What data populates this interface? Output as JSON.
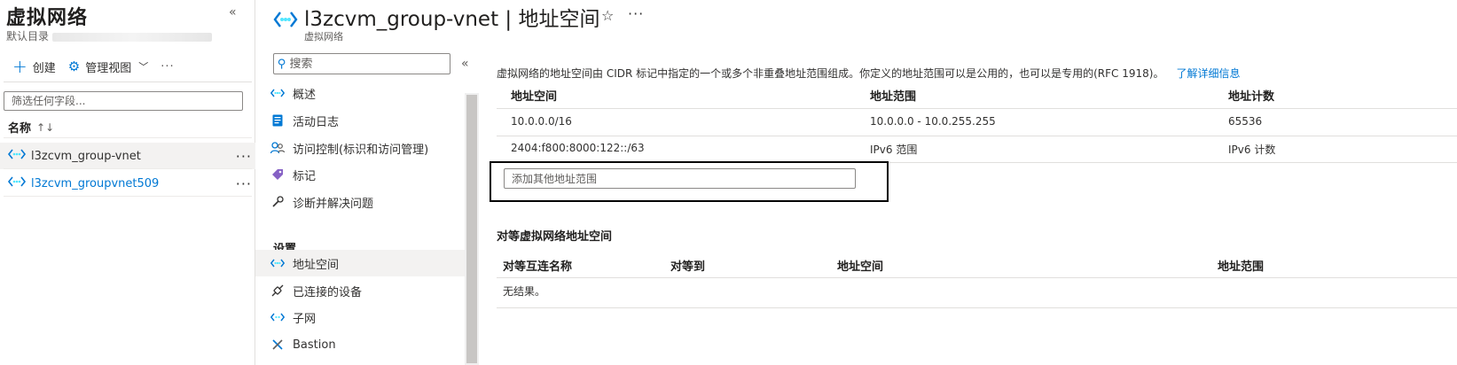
{
  "left_pane": {
    "title": "虚拟网络",
    "subtitle": "默认目录",
    "commands": {
      "create": "创建",
      "manage_view": "管理视图",
      "more": "···"
    },
    "filter_placeholder": "筛选任何字段...",
    "column_name": "名称",
    "sort_glyph": "↑↓",
    "items": [
      {
        "name": "l3zcvm_group-vnet",
        "selected": true
      },
      {
        "name": "l3zcvm_groupvnet509",
        "selected": false
      }
    ],
    "collapse_glyph": "«"
  },
  "middle_pane": {
    "title": "l3zcvm_group-vnet | 地址空间",
    "subtitle": "虚拟网络",
    "search_placeholder": "搜索",
    "collapse_glyph": "«",
    "nav_items": [
      {
        "label": "概述",
        "icon": "vnet-icon"
      },
      {
        "label": "活动日志",
        "icon": "activity-log-icon"
      },
      {
        "label": "访问控制(标识和访问管理)",
        "icon": "people-icon"
      },
      {
        "label": "标记",
        "icon": "tag-icon"
      },
      {
        "label": "诊断并解决问题",
        "icon": "wrench-icon"
      }
    ],
    "section_settings": "设置",
    "settings_items": [
      {
        "label": "地址空间",
        "icon": "vnet-icon",
        "selected": true
      },
      {
        "label": "已连接的设备",
        "icon": "plug-icon"
      },
      {
        "label": "子网",
        "icon": "subnet-icon"
      },
      {
        "label": "Bastion",
        "icon": "bastion-icon"
      }
    ]
  },
  "header": {
    "star": "☆",
    "more": "···"
  },
  "main": {
    "description": "虚拟网络的地址空间由 CIDR 标记中指定的一个或多个非重叠地址范围组成。你定义的地址范围可以是公用的，也可以是专用的(RFC 1918)。",
    "learn_more": "了解详细信息",
    "columns": [
      "地址空间",
      "地址范围",
      "地址计数"
    ],
    "rows": [
      [
        "10.0.0.0/16",
        "10.0.0.0 - 10.0.255.255",
        "65536"
      ],
      [
        "2404:f800:8000:122::/63",
        "IPv6 范围",
        "IPv6 计数"
      ]
    ],
    "add_placeholder": "添加其他地址范围",
    "peer_title": "对等虚拟网络地址空间",
    "peer_columns": [
      "对等互连名称",
      "对等到",
      "地址空间",
      "地址范围"
    ],
    "peer_empty": "无结果。"
  }
}
